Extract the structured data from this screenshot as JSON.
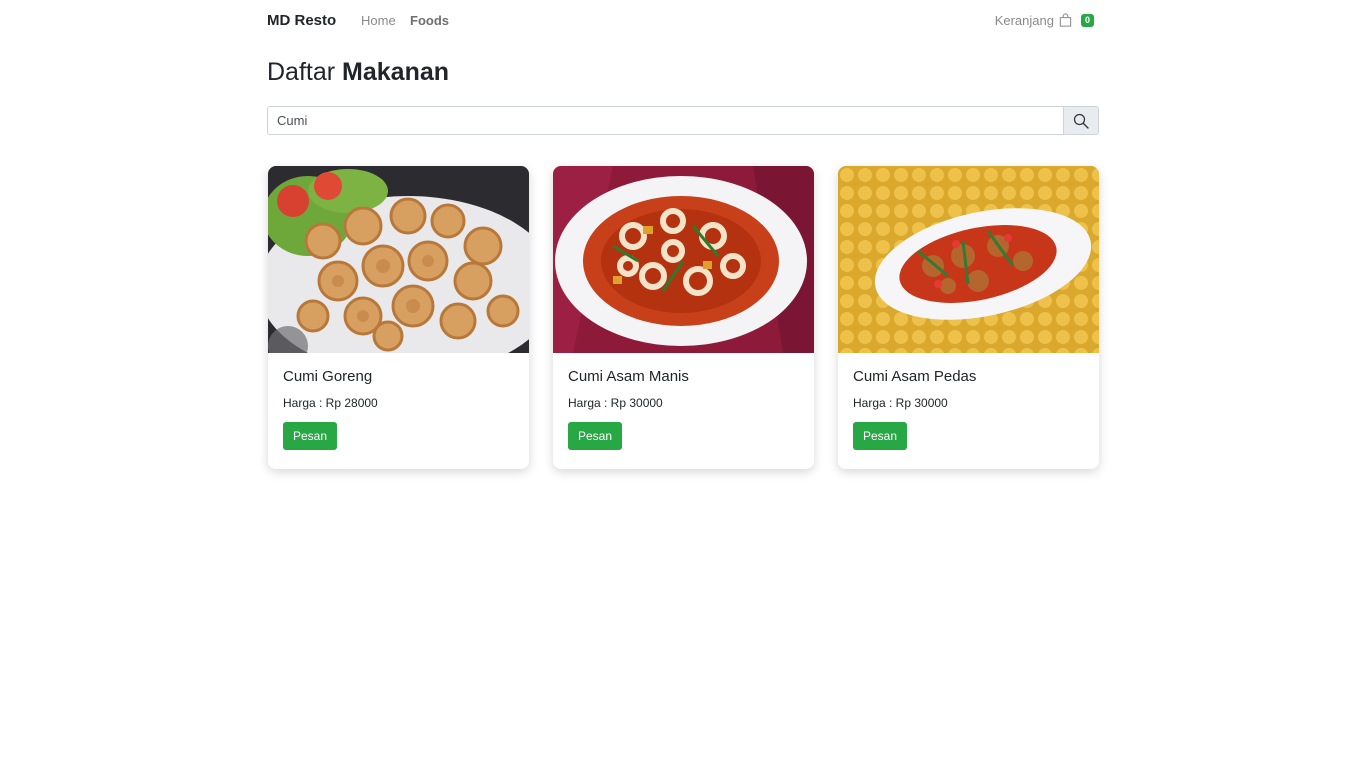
{
  "navbar": {
    "brand": "MD Resto",
    "links": [
      {
        "label": "Home"
      },
      {
        "label": "Foods"
      }
    ],
    "cart": {
      "label": "Keranjang",
      "count": "0",
      "icon": "shopping-bag-icon"
    }
  },
  "page": {
    "title_light": "Daftar",
    "title_bold": "Makanan"
  },
  "search": {
    "value": "Cumi",
    "icon": "search-icon"
  },
  "foods": [
    {
      "name": "Cumi Goreng",
      "price": "Harga : Rp 28000",
      "button": "Pesan"
    },
    {
      "name": "Cumi Asam Manis",
      "price": "Harga : Rp 30000",
      "button": "Pesan"
    },
    {
      "name": "Cumi Asam Pedas",
      "price": "Harga : Rp 30000",
      "button": "Pesan"
    }
  ],
  "colors": {
    "accent": "#28a745",
    "text": "#212529",
    "muted": "#8a8a8a"
  }
}
